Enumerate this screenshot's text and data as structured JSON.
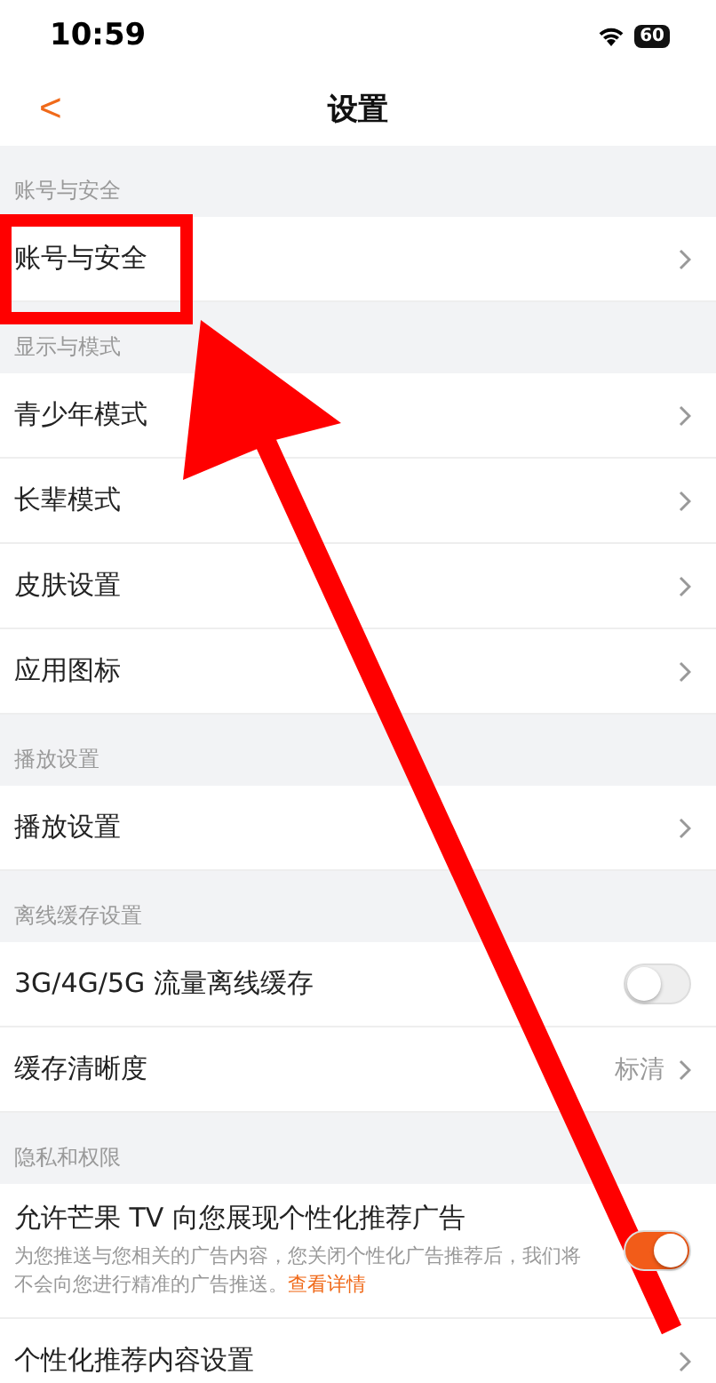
{
  "status_bar": {
    "time": "10:59",
    "battery": "60"
  },
  "nav": {
    "back": "<",
    "title": "设置"
  },
  "sections": [
    {
      "title": "账号与安全",
      "rows": [
        {
          "kind": "link",
          "label": "账号与安全"
        }
      ]
    },
    {
      "title": "显示与模式",
      "rows": [
        {
          "kind": "link",
          "label": "青少年模式"
        },
        {
          "kind": "link",
          "label": "长辈模式"
        },
        {
          "kind": "link",
          "label": "皮肤设置"
        },
        {
          "kind": "link",
          "label": "应用图标"
        }
      ]
    },
    {
      "title": "播放设置",
      "rows": [
        {
          "kind": "link",
          "label": "播放设置"
        }
      ]
    },
    {
      "title": "离线缓存设置",
      "rows": [
        {
          "kind": "toggle",
          "label": "3G/4G/5G 流量离线缓存",
          "on": false
        },
        {
          "kind": "link",
          "label": "缓存清晰度",
          "value": "标清"
        }
      ]
    },
    {
      "title": "隐私和权限",
      "rows": [
        {
          "kind": "toggle",
          "label": "允许芒果 TV 向您展现个性化推荐广告",
          "on": true,
          "description": "为您推送与您相关的广告内容，您关闭个性化广告推荐后，我们将不会向您进行精准的广告推送。",
          "link": "查看详情"
        },
        {
          "kind": "link",
          "label": "个性化推荐内容设置"
        }
      ]
    }
  ]
}
